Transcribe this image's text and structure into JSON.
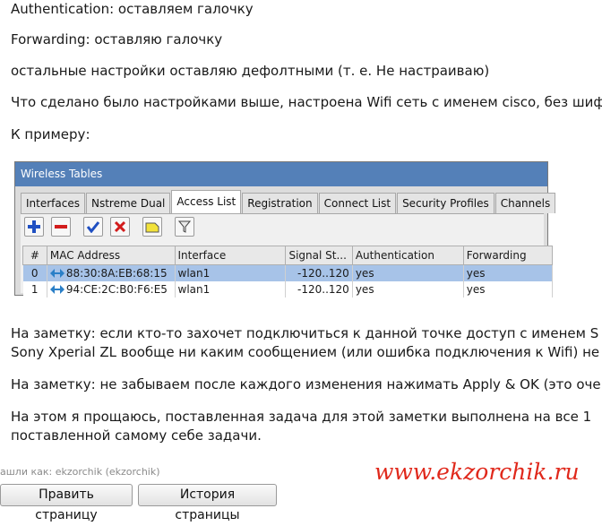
{
  "article": {
    "p1": "Authentication: оставляем галочку",
    "p2": "Forwarding: оставляю галочку",
    "p3": "остальные настройки оставляю дефолтными (т. е. Не настраиваю)",
    "p4": "Что сделано было настройками выше, настроена Wifi сеть с именем cisco, без шиф",
    "p5": "К примеру:",
    "p6a": "На заметку: если кто-то захочет подключиться к данной точке доступ с именем S",
    "p6b": "Sony Xperial ZL вообще ни каким сообщением (или ошибка подключения к Wifi) не",
    "p7": "На заметку: не забываем после каждого изменения нажимать Apply & OK (это оче",
    "p8a": "На этом я прощаюсь, поставленная задача для этой заметки выполнена на все 1",
    "p8b": "поставленной самому себе задачи."
  },
  "window": {
    "title": "Wireless Tables",
    "tabs": [
      "Interfaces",
      "Nstreme Dual",
      "Access List",
      "Registration",
      "Connect List",
      "Security Profiles",
      "Channels"
    ],
    "active_tab": "Access List",
    "toolbar_icons": [
      "add-icon",
      "remove-icon",
      "enable-check-icon",
      "disable-x-icon",
      "comment-icon",
      "filter-icon"
    ],
    "columns": [
      "#",
      "MAC Address",
      "Interface",
      "Signal St...",
      "Authentication",
      "Forwarding"
    ],
    "rows": [
      {
        "num": "0",
        "mac": "88:30:8A:EB:68:15",
        "iface": "wlan1",
        "signal": "-120..120",
        "auth": "yes",
        "fwd": "yes",
        "selected": true
      },
      {
        "num": "1",
        "mac": "94:CE:2C:B0:F6:E5",
        "iface": "wlan1",
        "signal": "-120..120",
        "auth": "yes",
        "fwd": "yes",
        "selected": false
      }
    ]
  },
  "footer": {
    "found_by": "ашли как: ekzorchik (ekzorchik)",
    "watermark": "www.ekzorchik.ru",
    "edit_button": "Править страницу",
    "history_button": "История страницы"
  },
  "colors": {
    "title_bar": "#5480b8",
    "selected_row": "#a7c3e8",
    "watermark": "#e0281b"
  }
}
